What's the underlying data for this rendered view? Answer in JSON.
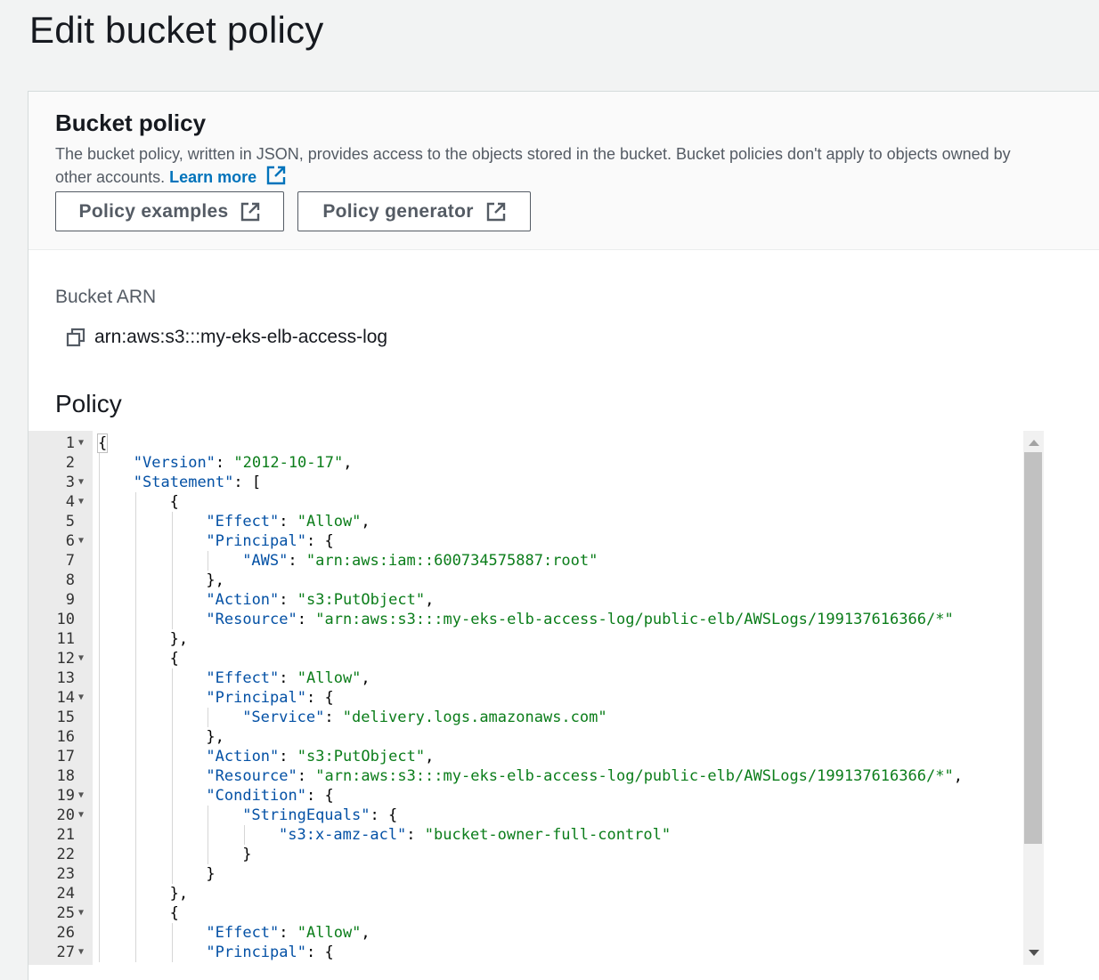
{
  "page": {
    "title": "Edit bucket policy"
  },
  "section": {
    "title": "Bucket policy",
    "description": "The bucket policy, written in JSON, provides access to the objects stored in the bucket. Bucket policies don't apply to objects owned by other accounts.",
    "learn_more": "Learn more",
    "buttons": {
      "examples": "Policy examples",
      "generator": "Policy generator"
    }
  },
  "arn": {
    "label": "Bucket ARN",
    "value": "arn:aws:s3:::my-eks-elb-access-log"
  },
  "policy": {
    "label": "Policy",
    "lines": [
      {
        "n": "1",
        "fold": true,
        "indent": 0,
        "tokens": [
          [
            "p",
            "{"
          ]
        ]
      },
      {
        "n": "2",
        "fold": false,
        "indent": 1,
        "tokens": [
          [
            "k",
            "\"Version\""
          ],
          [
            "p",
            ": "
          ],
          [
            "s",
            "\"2012-10-17\""
          ],
          [
            "p",
            ","
          ]
        ]
      },
      {
        "n": "3",
        "fold": true,
        "indent": 1,
        "tokens": [
          [
            "k",
            "\"Statement\""
          ],
          [
            "p",
            ": ["
          ]
        ]
      },
      {
        "n": "4",
        "fold": true,
        "indent": 2,
        "tokens": [
          [
            "p",
            "{"
          ]
        ]
      },
      {
        "n": "5",
        "fold": false,
        "indent": 3,
        "tokens": [
          [
            "k",
            "\"Effect\""
          ],
          [
            "p",
            ": "
          ],
          [
            "s",
            "\"Allow\""
          ],
          [
            "p",
            ","
          ]
        ]
      },
      {
        "n": "6",
        "fold": true,
        "indent": 3,
        "tokens": [
          [
            "k",
            "\"Principal\""
          ],
          [
            "p",
            ": {"
          ]
        ]
      },
      {
        "n": "7",
        "fold": false,
        "indent": 4,
        "tokens": [
          [
            "k",
            "\"AWS\""
          ],
          [
            "p",
            ": "
          ],
          [
            "s",
            "\"arn:aws:iam::600734575887:root\""
          ]
        ]
      },
      {
        "n": "8",
        "fold": false,
        "indent": 3,
        "tokens": [
          [
            "p",
            "},"
          ]
        ]
      },
      {
        "n": "9",
        "fold": false,
        "indent": 3,
        "tokens": [
          [
            "k",
            "\"Action\""
          ],
          [
            "p",
            ": "
          ],
          [
            "s",
            "\"s3:PutObject\""
          ],
          [
            "p",
            ","
          ]
        ]
      },
      {
        "n": "10",
        "fold": false,
        "indent": 3,
        "tokens": [
          [
            "k",
            "\"Resource\""
          ],
          [
            "p",
            ": "
          ],
          [
            "s",
            "\"arn:aws:s3:::my-eks-elb-access-log/public-elb/AWSLogs/199137616366/*\""
          ]
        ]
      },
      {
        "n": "11",
        "fold": false,
        "indent": 2,
        "tokens": [
          [
            "p",
            "},"
          ]
        ]
      },
      {
        "n": "12",
        "fold": true,
        "indent": 2,
        "tokens": [
          [
            "p",
            "{"
          ]
        ]
      },
      {
        "n": "13",
        "fold": false,
        "indent": 3,
        "tokens": [
          [
            "k",
            "\"Effect\""
          ],
          [
            "p",
            ": "
          ],
          [
            "s",
            "\"Allow\""
          ],
          [
            "p",
            ","
          ]
        ]
      },
      {
        "n": "14",
        "fold": true,
        "indent": 3,
        "tokens": [
          [
            "k",
            "\"Principal\""
          ],
          [
            "p",
            ": {"
          ]
        ]
      },
      {
        "n": "15",
        "fold": false,
        "indent": 4,
        "tokens": [
          [
            "k",
            "\"Service\""
          ],
          [
            "p",
            ": "
          ],
          [
            "s",
            "\"delivery.logs.amazonaws.com\""
          ]
        ]
      },
      {
        "n": "16",
        "fold": false,
        "indent": 3,
        "tokens": [
          [
            "p",
            "},"
          ]
        ]
      },
      {
        "n": "17",
        "fold": false,
        "indent": 3,
        "tokens": [
          [
            "k",
            "\"Action\""
          ],
          [
            "p",
            ": "
          ],
          [
            "s",
            "\"s3:PutObject\""
          ],
          [
            "p",
            ","
          ]
        ]
      },
      {
        "n": "18",
        "fold": false,
        "indent": 3,
        "tokens": [
          [
            "k",
            "\"Resource\""
          ],
          [
            "p",
            ": "
          ],
          [
            "s",
            "\"arn:aws:s3:::my-eks-elb-access-log/public-elb/AWSLogs/199137616366/*\""
          ],
          [
            "p",
            ","
          ]
        ]
      },
      {
        "n": "19",
        "fold": true,
        "indent": 3,
        "tokens": [
          [
            "k",
            "\"Condition\""
          ],
          [
            "p",
            ": {"
          ]
        ]
      },
      {
        "n": "20",
        "fold": true,
        "indent": 4,
        "tokens": [
          [
            "k",
            "\"StringEquals\""
          ],
          [
            "p",
            ": {"
          ]
        ]
      },
      {
        "n": "21",
        "fold": false,
        "indent": 5,
        "tokens": [
          [
            "k",
            "\"s3:x-amz-acl\""
          ],
          [
            "p",
            ": "
          ],
          [
            "s",
            "\"bucket-owner-full-control\""
          ]
        ]
      },
      {
        "n": "22",
        "fold": false,
        "indent": 4,
        "tokens": [
          [
            "p",
            "}"
          ]
        ]
      },
      {
        "n": "23",
        "fold": false,
        "indent": 3,
        "tokens": [
          [
            "p",
            "}"
          ]
        ]
      },
      {
        "n": "24",
        "fold": false,
        "indent": 2,
        "tokens": [
          [
            "p",
            "},"
          ]
        ]
      },
      {
        "n": "25",
        "fold": true,
        "indent": 2,
        "tokens": [
          [
            "p",
            "{"
          ]
        ]
      },
      {
        "n": "26",
        "fold": false,
        "indent": 3,
        "tokens": [
          [
            "k",
            "\"Effect\""
          ],
          [
            "p",
            ": "
          ],
          [
            "s",
            "\"Allow\""
          ],
          [
            "p",
            ","
          ]
        ]
      },
      {
        "n": "27",
        "fold": true,
        "indent": 3,
        "tokens": [
          [
            "k",
            "\"Principal\""
          ],
          [
            "p",
            ": {"
          ]
        ]
      }
    ]
  },
  "colors": {
    "accent": "#0073bb",
    "key": "#0451a5",
    "string": "#0b7d1a"
  },
  "icons": {
    "external": "external-link-icon",
    "copy": "copy-icon",
    "fold": "fold-arrow-icon"
  }
}
